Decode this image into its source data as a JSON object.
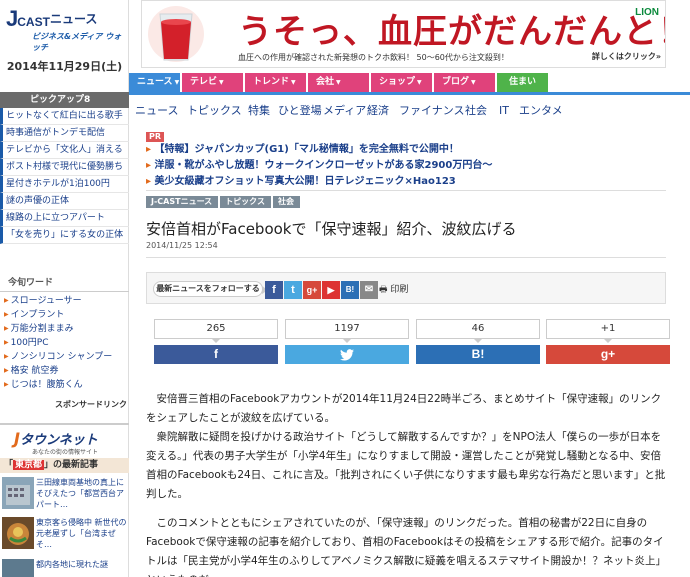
{
  "site": {
    "logo_main": "J",
    "logo_cast": "CAST",
    "logo_news": "ニュース",
    "logo_sub": "ビジネス&メディア ウォッチ",
    "date": "2014年11月29日(土)"
  },
  "pickup": {
    "header": "ピックアップ8",
    "items": [
      "ヒットなくて紅白に出る歌手",
      "時事通信がトンデモ配信",
      "テレビから「文化人」消える",
      "ポスト村様で現代に優勢勝ち",
      "星付きホテルが1泊100円",
      "謎の声優の正体",
      "線路の上に立つアパート",
      "「女を売り」にする女の正体"
    ]
  },
  "keywords": {
    "header": "今旬ワード",
    "items": [
      "スロージューサー",
      "インプラント",
      "万能分割ままみ",
      "100円PC",
      "ノンシリコン シャンプー",
      "格安 航空券",
      "じつは！腹筋くん"
    ],
    "sponsor": "スポンサードリンク"
  },
  "townnet": {
    "logo": "タウンネット",
    "sub": "あなたの街の情報サイト",
    "section_header_tag": "東京都",
    "section_header_rest": "」の最新記事",
    "items": [
      "三田線車両基地の真上にそびえたつ「都営西台アパート…",
      "東京客ら侵略中 新世代の元老屋ずし「台湾まぜそ…",
      "都内各地に現れた謎"
    ]
  },
  "banner": {
    "headline": "うそっ、血圧がだんだんと！",
    "brand": "LION",
    "desc": "血圧への作用が確認された新発想のトクホ飲料！ 50～60代から注文殺到！",
    "more": "詳しくはクリック»"
  },
  "nav": {
    "tabs": [
      {
        "label": "ニュース",
        "color": "#3b8bd8"
      },
      {
        "label": "テレビ",
        "color": "#e0427b"
      },
      {
        "label": "トレンド",
        "color": "#e0427b"
      },
      {
        "label": "会社",
        "color": "#e0427b"
      },
      {
        "label": "ショップ",
        "color": "#e0427b"
      },
      {
        "label": "ブログ",
        "color": "#e0427b"
      },
      {
        "label": "住まい",
        "color": "#4fb34a"
      }
    ],
    "subnav": [
      "ニュース",
      "トピックス",
      "特集",
      "ひと登場",
      "メディア",
      "経済",
      "ファイナンス",
      "社会",
      "IT",
      "エンタメ"
    ]
  },
  "pr": {
    "tag": "PR",
    "lines": [
      "【特報】ジャパンカップ(G1)「マル秘情報」を完全無料で公開中！",
      "洋服・靴がふやし放題！ウォークインクローゼットがある家2900万円台～",
      "美少女級藏オフショット写真大公開！日テレジェニック×Hao123"
    ]
  },
  "breadcrumb": [
    "J-CASTニュース",
    "トピックス",
    "社会"
  ],
  "article": {
    "title": "安倍首相がFacebookで「保守速報」紹介、波紋広げる",
    "date": "2014/11/25 12:54",
    "follow_label": "最新ニュースをフォローする",
    "print_label": "印刷",
    "paragraphs": [
      "安倍晋三首相のFacebookアカウントが2014年11月24日22時半ごろ、まとめサイト「保守速報」のリンクをシェアしたことが波紋を広げている。",
      "衆院解散に疑問を投げかける政治サイト「どうして解散するんですか？」をNPO法人「僕らの一歩が日本を変える。」代表の男子大学生が「小学4年生」になりすまして開設・運営したことが発覚し騒動となる中、安倍首相のFacebookも24日、これに言及。「批判されにくい子供になりすます最も卑劣な行為だと思います」と批判した。",
      "このコメントとともにシェアされていたのが、「保守速報」のリンクだった。首相の秘書が22日に自身のFacebookで保守速報の記事を紹介しており、首相のFacebookはその投稿をシェアする形で紹介。記事のタイトルは「民主党が小学4年生のふりしてアベノミクス解散に疑義を唱えるステマサイト開設か！？ネット炎上」というものだ。"
    ]
  },
  "share": {
    "counts": [
      "265",
      "1197",
      "46",
      "+1"
    ],
    "buttons": [
      {
        "label": "f",
        "color": "#3b5a9a"
      },
      {
        "label": "🐦",
        "color": "#4aa8e0"
      },
      {
        "label": "B!",
        "color": "#2c6fb5"
      },
      {
        "label": "g+",
        "color": "#d6493b"
      }
    ]
  },
  "social_icons": [
    {
      "label": "f",
      "color": "#3b5a9a"
    },
    {
      "label": "t",
      "color": "#4aa8e0"
    },
    {
      "label": "g+",
      "color": "#d6493b"
    },
    {
      "label": "▶",
      "color": "#d33"
    },
    {
      "label": "B!",
      "color": "#2c6fb5"
    },
    {
      "label": "✉",
      "color": "#888"
    }
  ]
}
